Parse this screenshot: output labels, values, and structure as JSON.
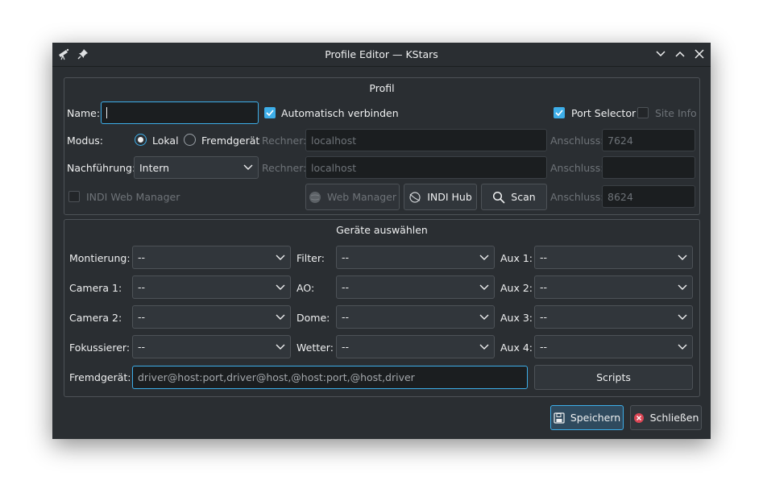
{
  "window": {
    "title": "Profile Editor — KStars",
    "controls": {
      "minimize": "chevron-down-icon",
      "maximize": "chevron-up-icon",
      "close": "close-icon"
    }
  },
  "profil": {
    "heading": "Profil",
    "name_label": "Name:",
    "name_value": "",
    "auto_connect_label": "Automatisch verbinden",
    "auto_connect_checked": true,
    "port_selector_label": "Port Selector",
    "port_selector_checked": true,
    "site_info_label": "Site Info",
    "site_info_checked": false,
    "mode_label": "Modus:",
    "mode_local": "Lokal",
    "mode_remote": "Fremdgerät",
    "mode_selected": "Lokal",
    "host_label": "Rechner:",
    "host_value": "localhost",
    "port_label": "Anschluss:",
    "port_value": "7624",
    "guiding_label": "Nachführung:",
    "guiding_value": "Intern",
    "guide_host_label": "Rechner:",
    "guide_host_value": "localhost",
    "guide_port_label": "Anschluss:",
    "guide_port_value": "",
    "web_manager_checkbox_label": "INDI Web Manager",
    "web_manager_checked": false,
    "web_manager_button": "Web Manager",
    "indi_hub_button": "INDI Hub",
    "scan_button": "Scan",
    "wm_port_label": "Anschluss:",
    "wm_port_value": "8624"
  },
  "devices": {
    "heading": "Geräte auswählen",
    "mount_label": "Montierung:",
    "mount_value": "--",
    "camera1_label": "Camera 1:",
    "camera1_value": "--",
    "camera2_label": "Camera 2:",
    "camera2_value": "--",
    "focuser_label": "Fokussierer:",
    "focuser_value": "--",
    "filter_label": "Filter:",
    "filter_value": "--",
    "ao_label": "AO:",
    "ao_value": "--",
    "dome_label": "Dome:",
    "dome_value": "--",
    "weather_label": "Wetter:",
    "weather_value": "--",
    "aux1_label": "Aux 1:",
    "aux1_value": "--",
    "aux2_label": "Aux 2:",
    "aux2_value": "--",
    "aux3_label": "Aux 3:",
    "aux3_value": "--",
    "aux4_label": "Aux 4:",
    "aux4_value": "--",
    "remote_label": "Fremdgerät:",
    "remote_placeholder": "driver@host:port,driver@host,@host:port,@host,driver",
    "scripts_button": "Scripts"
  },
  "footer": {
    "save_button": "Speichern",
    "close_button": "Schließen"
  },
  "colors": {
    "accent": "#3daee9",
    "background": "#2a2e32",
    "close_red": "#da4453"
  }
}
